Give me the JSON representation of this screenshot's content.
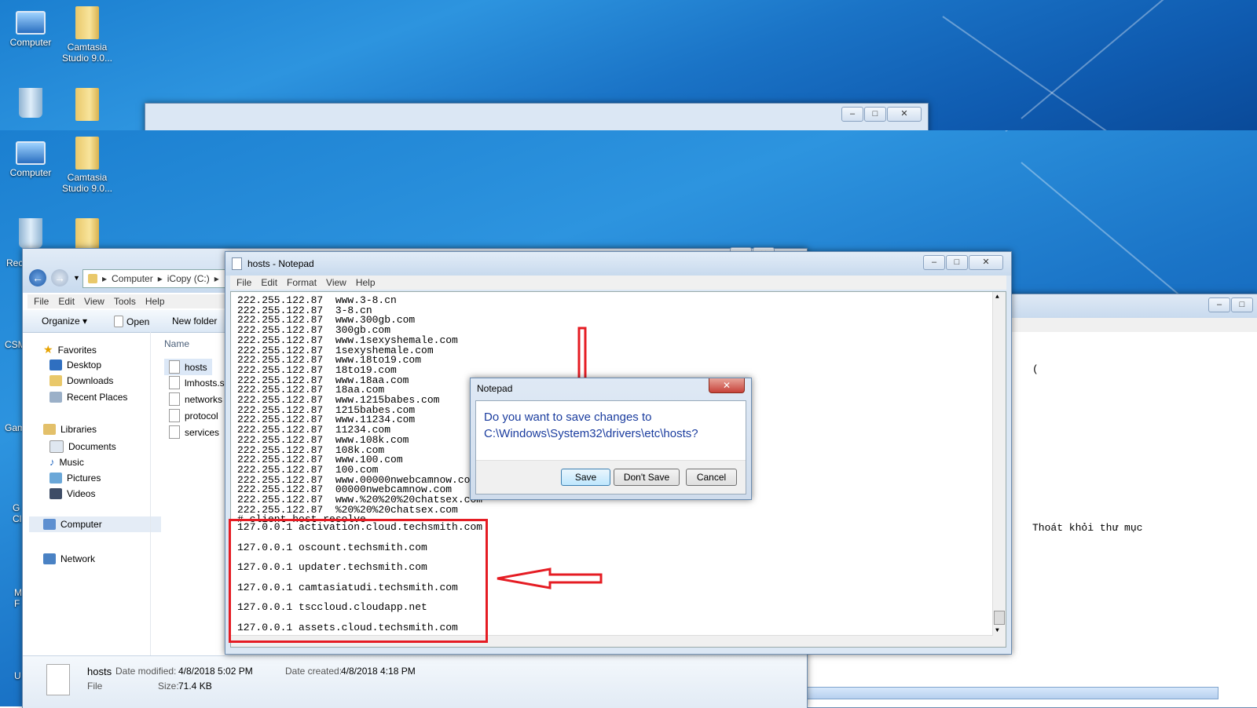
{
  "desktop": {
    "icons": {
      "computer": "Computer",
      "camtasia": "Camtasia Studio 9.0...",
      "recycle_bin_partial": "Rec",
      "side_csm": "CSM",
      "side_gam": "Gam",
      "side_g": "G",
      "side_ci": "Cl",
      "side_m": "M",
      "side_f": "F",
      "side_u": "U"
    }
  },
  "explorer": {
    "breadcrumb": [
      "Computer",
      "iCopy (C:)"
    ],
    "menu": [
      "File",
      "Edit",
      "View",
      "Tools",
      "Help"
    ],
    "toolbar": {
      "organize": "Organize",
      "open": "Open",
      "new_folder": "New folder"
    },
    "nav": {
      "favorites": "Favorites",
      "favorites_items": [
        "Desktop",
        "Downloads",
        "Recent Places"
      ],
      "libraries": "Libraries",
      "libraries_items": [
        "Documents",
        "Music",
        "Pictures",
        "Videos"
      ],
      "computer": "Computer",
      "network": "Network"
    },
    "column_name": "Name",
    "files": [
      "hosts",
      "lmhosts.sa",
      "networks",
      "protocol",
      "services"
    ],
    "details": {
      "name": "hosts",
      "type": "File",
      "modified_label": "Date modified:",
      "modified": "4/8/2018 5:02 PM",
      "created_label": "Date created:",
      "created": "4/8/2018 4:18 PM",
      "size_label": "Size:",
      "size": "71.4 KB"
    }
  },
  "notepad": {
    "title": "hosts - Notepad",
    "menu": [
      "File",
      "Edit",
      "Format",
      "View",
      "Help"
    ],
    "lines": [
      "222.255.122.87  www.3-8.cn",
      "222.255.122.87  3-8.cn",
      "222.255.122.87  www.300gb.com",
      "222.255.122.87  300gb.com",
      "222.255.122.87  www.1sexyshemale.com",
      "222.255.122.87  1sexyshemale.com",
      "222.255.122.87  www.18to19.com",
      "222.255.122.87  18to19.com",
      "222.255.122.87  www.18aa.com",
      "222.255.122.87  18aa.com",
      "222.255.122.87  www.1215babes.com",
      "222.255.122.87  1215babes.com",
      "222.255.122.87  www.11234.com",
      "222.255.122.87  11234.com",
      "222.255.122.87  www.108k.com",
      "222.255.122.87  108k.com",
      "222.255.122.87  www.100.com",
      "222.255.122.87  100.com",
      "222.255.122.87  www.00000nwebcamnow.com",
      "222.255.122.87  00000nwebcamnow.com",
      "222.255.122.87  www.%20%20%20chatsex.com",
      "222.255.122.87  %20%20%20chatsex.com",
      "# client host resolve"
    ],
    "added_lines": [
      "127.0.0.1 activation.cloud.techsmith.com",
      "127.0.0.1 oscount.techsmith.com",
      "127.0.0.1 updater.techsmith.com",
      "127.0.0.1 camtasiatudi.techsmith.com",
      "127.0.0.1 tsccloud.cloudapp.net",
      "127.0.0.1 assets.cloud.techsmith.com"
    ]
  },
  "dialog": {
    "title": "Notepad",
    "message_line1": "Do you want to save changes to",
    "message_line2": "C:\\Windows\\System32\\drivers\\etc\\hosts?",
    "save": "Save",
    "dont_save": "Don't Save",
    "cancel": "Cancel"
  },
  "right_window": {
    "text": "Thoát khỏi thư mục",
    "paren": "("
  },
  "colors": {
    "highlight": "#e51c23",
    "dialog_text": "#1a3c9e"
  }
}
